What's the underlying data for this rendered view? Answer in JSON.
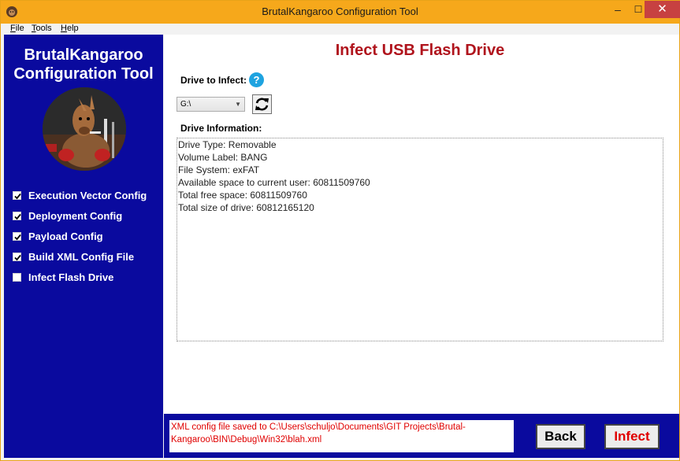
{
  "window": {
    "title": "BrutalKangaroo Configuration Tool",
    "minimize_glyph": "–",
    "maximize_glyph": "☐",
    "close_glyph": "✕"
  },
  "menu": [
    {
      "prefix": "",
      "accel": "F",
      "rest": "ile"
    },
    {
      "prefix": "",
      "accel": "T",
      "rest": "ools"
    },
    {
      "prefix": "",
      "accel": "H",
      "rest": "elp"
    }
  ],
  "sidebar": {
    "title_line1": "BrutalKangaroo",
    "title_line2": "Configuration Tool",
    "steps": [
      {
        "label": "Execution Vector Config",
        "checked": true
      },
      {
        "label": "Deployment Config",
        "checked": true
      },
      {
        "label": "Payload Config",
        "checked": true
      },
      {
        "label": "Build XML Config File",
        "checked": true
      },
      {
        "label": "Infect Flash Drive",
        "checked": false
      }
    ]
  },
  "main": {
    "title": "Infect USB Flash Drive",
    "drive_label": "Drive to Infect:",
    "help_glyph": "?",
    "drive_value": "G:\\",
    "info_label": "Drive Information:",
    "info_lines": [
      "Drive Type: Removable",
      "Volume Label: BANG",
      "File System: exFAT",
      "Available space to current user: 60811509760",
      "Total free space: 60811509760",
      "Total size of drive: 60812165120"
    ]
  },
  "footer": {
    "status_line1": "XML config file saved to C:\\Users\\schuljo\\Documents\\GIT Projects\\Brutal-",
    "status_line2": "Kangaroo\\BIN\\Debug\\Win32\\blah.xml",
    "back_label": "Back",
    "infect_label": "Infect"
  },
  "colors": {
    "titlebar": "#f6a81b",
    "sidebar": "#0a0a9e",
    "accent_red": "#b0141d",
    "status_red": "#e00000",
    "help_blue": "#1ea3e0"
  }
}
